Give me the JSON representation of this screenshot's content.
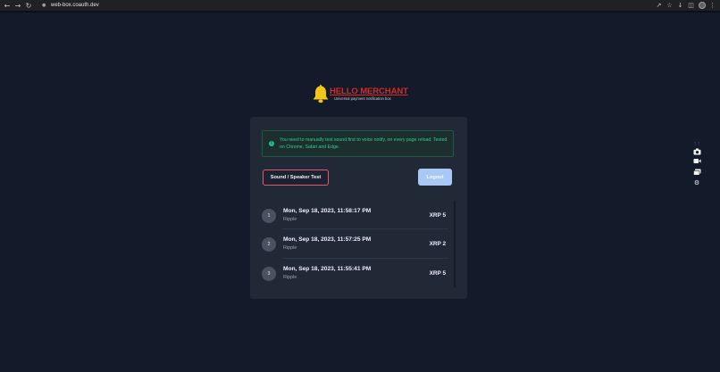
{
  "browser": {
    "url": "web-box.coauth.dev",
    "icons": [
      "back-icon",
      "forward-icon",
      "reload-icon",
      "lock-icon",
      "share-icon",
      "star-icon",
      "download-icon",
      "sidebar-icon",
      "profile-icon",
      "menu-icon"
    ]
  },
  "logo": {
    "title": "HELLO MERCHANT",
    "subtitle": "Universal payment notification box",
    "bell_color": "#f5c518",
    "title_color": "#d62b2b"
  },
  "alert": {
    "text": "You need to manually test sound first to voice notify, on every page reload. Tested on Chrome, Safari and Edge.",
    "color": "#2fd088"
  },
  "buttons": {
    "sound_test": "Sound / Speaker Test",
    "logout": "Logout"
  },
  "transactions": [
    {
      "index": "1",
      "datetime": "Mon, Sep 18, 2023, 11:58:17 PM",
      "coin": "Ripple",
      "amount": "XRP 5"
    },
    {
      "index": "2",
      "datetime": "Mon, Sep 18, 2023, 11:57:25 PM",
      "coin": "Ripple",
      "amount": "XRP 2"
    },
    {
      "index": "3",
      "datetime": "Mon, Sep 18, 2023, 11:55:41 PM",
      "coin": "Ripple",
      "amount": "XRP 5"
    }
  ],
  "side_tools": [
    "camera-icon",
    "video-icon",
    "gallery-icon",
    "settings-icon"
  ]
}
